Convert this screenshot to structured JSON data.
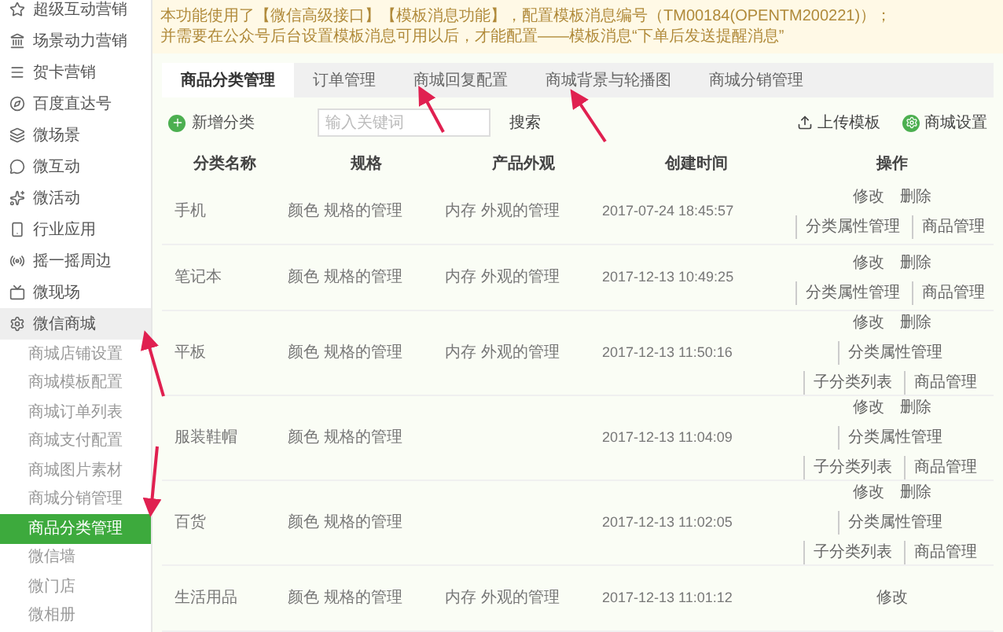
{
  "sidebar": {
    "items": [
      {
        "label": "超级互动营销",
        "expanded": false
      },
      {
        "label": "场景动力营销",
        "expanded": false
      },
      {
        "label": "贺卡营销",
        "expanded": false
      },
      {
        "label": "百度直达号",
        "expanded": false
      },
      {
        "label": "微场景",
        "expanded": false
      },
      {
        "label": "微互动",
        "expanded": false
      },
      {
        "label": "微活动",
        "expanded": false
      },
      {
        "label": "行业应用",
        "expanded": false
      },
      {
        "label": "摇一摇周边",
        "expanded": false
      },
      {
        "label": "微现场",
        "expanded": false
      },
      {
        "label": "微信商城",
        "expanded": true,
        "children": [
          {
            "label": "商城店铺设置",
            "selected": false
          },
          {
            "label": "商城模板配置",
            "selected": false
          },
          {
            "label": "商城订单列表",
            "selected": false
          },
          {
            "label": "商城支付配置",
            "selected": false
          },
          {
            "label": "商城图片素材",
            "selected": false
          },
          {
            "label": "商城分销管理",
            "selected": false
          },
          {
            "label": "商品分类管理",
            "selected": true
          },
          {
            "label": "微信墙",
            "selected": false
          },
          {
            "label": "微门店",
            "selected": false
          },
          {
            "label": "微相册",
            "selected": false
          }
        ]
      }
    ]
  },
  "notice": {
    "lines": [
      "本功能使用了【微信高级接口】【模板消息功能】，配置模板消息编号（TM00184(OPENTM200221)）；",
      "并需要在公众号后台设置模板消息可用以后，才能配置——模板消息“下单后发送提醒消息”"
    ]
  },
  "tabs": [
    {
      "label": "商品分类管理",
      "selected": true
    },
    {
      "label": "订单管理",
      "selected": false
    },
    {
      "label": "商城回复配置",
      "selected": false
    },
    {
      "label": "商城背景与轮播图",
      "selected": false
    },
    {
      "label": "商城分销管理",
      "selected": false
    }
  ],
  "toolbar": {
    "add_button": "新增分类",
    "search": {
      "placeholder": "输入关键词"
    },
    "search_button": "搜索",
    "upload_button": "上传模板",
    "settings_button": "商城设置"
  },
  "table": {
    "columns": [
      "分类名称",
      "规格",
      "产品外观",
      "创建时间",
      "操作"
    ],
    "rows": [
      {
        "cells": [
          "手机",
          "颜色  规格的管理",
          "内存  外观的管理",
          "2017-07-24 18:45:57"
        ],
        "actions": [
          "修改",
          "删除",
          "分类属性管理",
          "商品管理"
        ]
      },
      {
        "cells": [
          "笔记本",
          "颜色  规格的管理",
          "内存  外观的管理",
          "2017-12-13 10:49:25"
        ],
        "actions": [
          "修改",
          "删除",
          "分类属性管理",
          "商品管理"
        ]
      },
      {
        "cells": [
          "平板",
          "颜色  规格的管理",
          "内存  外观的管理",
          "2017-12-13 11:50:16"
        ],
        "actions": [
          "修改",
          "删除",
          "分类属性管理",
          "子分类列表",
          "商品管理"
        ]
      },
      {
        "cells": [
          "服装鞋帽",
          "颜色  规格的管理",
          "",
          "2017-12-13 11:04:09"
        ],
        "actions": [
          "修改",
          "删除",
          "分类属性管理",
          "子分类列表",
          "商品管理"
        ]
      },
      {
        "cells": [
          "百货",
          "颜色  规格的管理",
          "",
          "2017-12-13 11:02:05"
        ],
        "actions": [
          "修改",
          "删除",
          "分类属性管理",
          "子分类列表",
          "商品管理"
        ]
      },
      {
        "cells": [
          "生活用品",
          "颜色  规格的管理",
          "内存  外观的管理",
          "2017-12-13 11:01:12"
        ],
        "actions": [
          "修改"
        ]
      }
    ]
  }
}
